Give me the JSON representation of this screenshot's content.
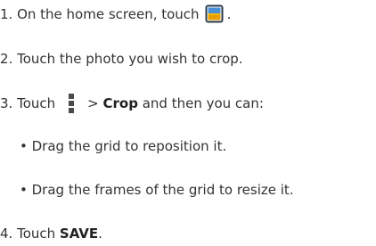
{
  "steps": [
    {
      "prefix": "1. On the home screen, touch",
      "suffix": "."
    },
    {
      "text": "2. Touch the photo you wish to crop."
    },
    {
      "prefix": "3. Touch",
      "sep": ">",
      "bold": "Crop",
      "suffix": " and then you can:"
    },
    {
      "text": "4. Touch ",
      "bold": "SAVE",
      "suffix": "."
    }
  ],
  "bullets": [
    "• Drag the grid to reposition it.",
    "• Drag the frames of the grid to resize it."
  ],
  "icons": {
    "gallery": "gallery-icon",
    "menu": "menu-icon"
  },
  "colors": {
    "text": "#333333",
    "gallery_frame": "#2b3a4a",
    "gallery_sky": "#4a90d9",
    "gallery_sun": "#f5b800"
  }
}
